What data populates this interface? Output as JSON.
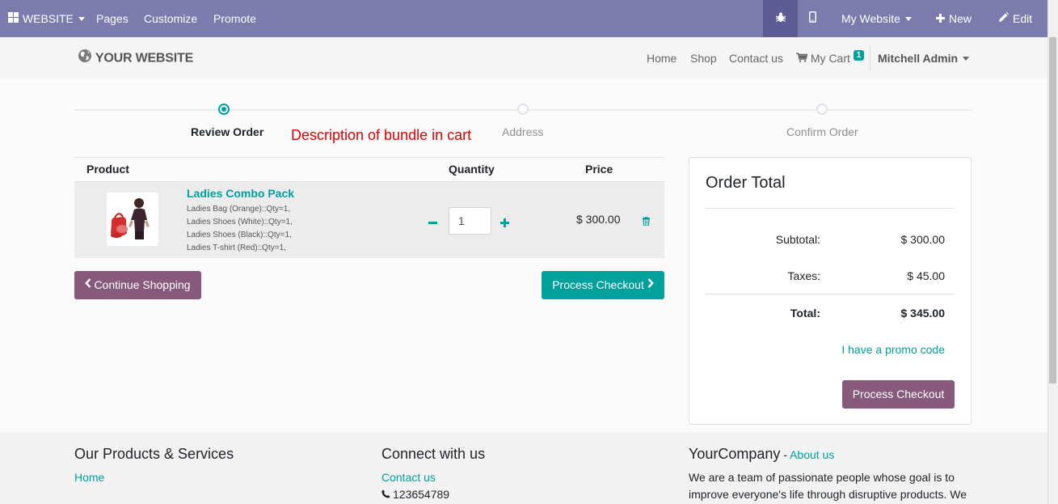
{
  "admin_bar": {
    "website_menu": "WEBSITE",
    "pages": "Pages",
    "customize": "Customize",
    "promote": "Promote",
    "my_website": "My Website",
    "new": "New",
    "edit": "Edit"
  },
  "site_nav": {
    "logo_text": "YOUR WEBSITE",
    "links": [
      "Home",
      "Shop",
      "Contact us"
    ],
    "cart_label": "My Cart",
    "cart_count": "1",
    "user": "Mitchell Admin"
  },
  "wizard": {
    "steps": [
      "Review Order",
      "Address",
      "Confirm Order"
    ],
    "active_step": 0,
    "annotation": "Description of bundle in cart"
  },
  "cart": {
    "headers": {
      "product": "Product",
      "quantity": "Quantity",
      "price": "Price"
    },
    "items": [
      {
        "name": "Ladies Combo Pack",
        "description_lines": [
          "Ladies Bag (Orange)::Qty=1,",
          "Ladies Shoes (White)::Qty=1,",
          "Ladies Shoes (Black)::Qty=1,",
          "Ladies T-shirt (Red)::Qty=1,"
        ],
        "quantity": "1",
        "price": "$ 300.00"
      }
    ],
    "continue_shopping": "Continue Shopping",
    "process_checkout": "Process Checkout"
  },
  "order_total": {
    "title": "Order Total",
    "subtotal_label": "Subtotal:",
    "subtotal_value": "$ 300.00",
    "taxes_label": "Taxes:",
    "taxes_value": "$ 45.00",
    "total_label": "Total:",
    "total_value": "$ 345.00",
    "promo_link": "I have a promo code",
    "process_checkout": "Process Checkout"
  },
  "footer": {
    "col1_title": "Our Products & Services",
    "col1_links": [
      "Home"
    ],
    "col2_title": "Connect with us",
    "col2_link": "Contact us",
    "col2_phone": "123654789",
    "col3_title": "YourCompany",
    "col3_sep": " - ",
    "col3_about": "About us",
    "col3_text": "We are a team of passionate people whose goal is to improve everyone's life through disruptive products. We"
  },
  "colors": {
    "admin_bar": "#7c7bad",
    "accent": "#00a09d",
    "secondary_button": "#875a7b",
    "annotation": "#e00000"
  }
}
